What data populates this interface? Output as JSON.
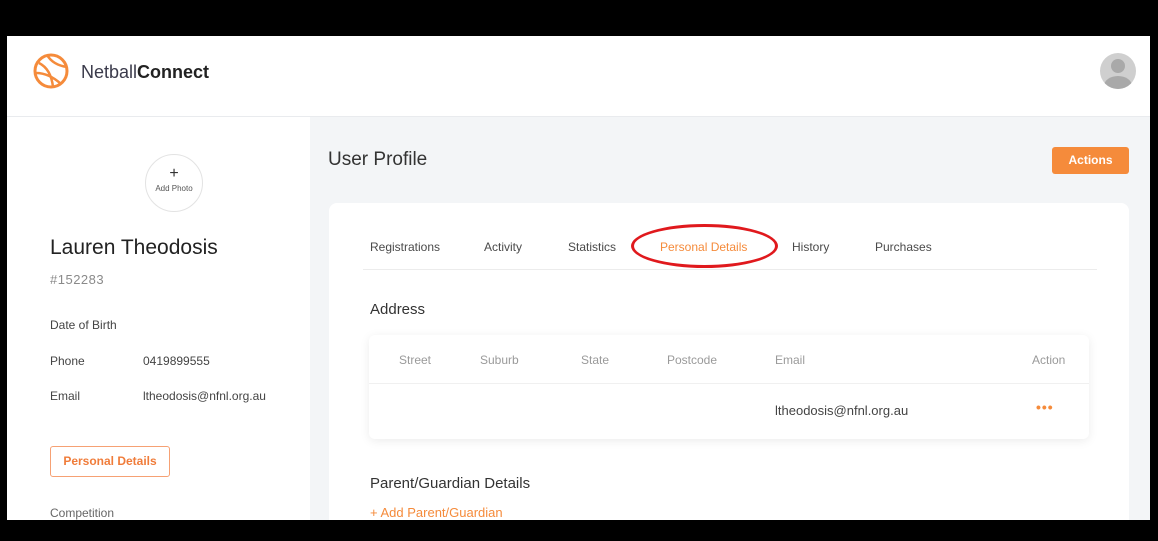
{
  "header": {
    "brand_prefix": "Netball",
    "brand_suffix": "Connect"
  },
  "sidebar": {
    "add_photo_plus": "+",
    "add_photo_label": "Add Photo",
    "user_name": "Lauren Theodosis",
    "user_id": "#152283",
    "dob_label": "Date of Birth",
    "phone_label": "Phone",
    "phone_value": "0419899555",
    "email_label": "Email",
    "email_value": "ltheodosis@nfnl.org.au",
    "personal_details_button": "Personal Details",
    "competition_label": "Competition"
  },
  "main": {
    "page_title": "User Profile",
    "actions_button": "Actions",
    "tabs": [
      {
        "label": "Registrations"
      },
      {
        "label": "Activity"
      },
      {
        "label": "Statistics"
      },
      {
        "label": "Personal Details"
      },
      {
        "label": "History"
      },
      {
        "label": "Purchases"
      }
    ],
    "active_tab": "Personal Details",
    "address": {
      "title": "Address",
      "columns": [
        "Street",
        "Suburb",
        "State",
        "Postcode",
        "Email",
        "Action"
      ],
      "rows": [
        {
          "street": "",
          "suburb": "",
          "state": "",
          "postcode": "",
          "email": "ltheodosis@nfnl.org.au",
          "action": "•••"
        }
      ]
    },
    "parent_guardian": {
      "title": "Parent/Guardian Details",
      "add_link": "+ Add Parent/Guardian"
    }
  },
  "colors": {
    "accent": "#f58b3b",
    "highlight_ring": "#e0191d",
    "background": "#f3f5f7"
  }
}
